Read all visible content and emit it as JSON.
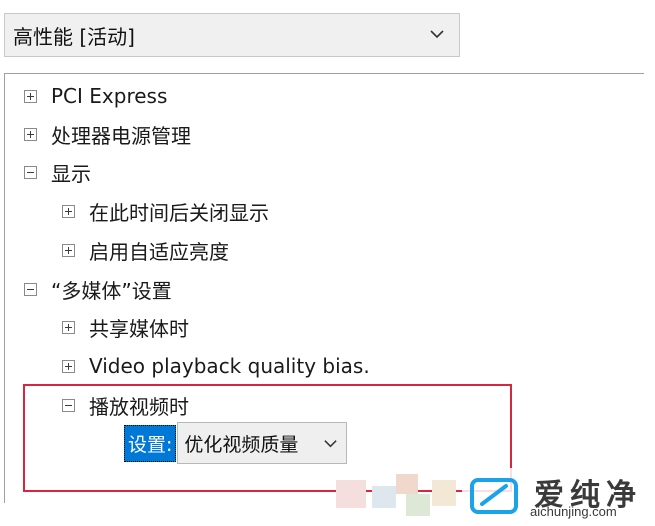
{
  "plan_select": {
    "value": "高性能 [活动]",
    "icon": "chevron-down-icon"
  },
  "tree": {
    "pci": {
      "label": "PCI Express",
      "state": "collapsed"
    },
    "cpu_power": {
      "label": "处理器电源管理",
      "state": "collapsed"
    },
    "display": {
      "label": "显示",
      "state": "expanded"
    },
    "display_off": {
      "label": "在此时间后关闭显示",
      "state": "collapsed"
    },
    "adaptive_brightness": {
      "label": "启用自适应亮度",
      "state": "collapsed"
    },
    "multimedia": {
      "label": "“多媒体”设置",
      "state": "expanded"
    },
    "media_sharing": {
      "label": "共享媒体时",
      "state": "collapsed"
    },
    "video_bias": {
      "label": "Video playback quality bias.",
      "state": "collapsed"
    },
    "play_video": {
      "label": "播放视频时",
      "state": "expanded"
    }
  },
  "setting": {
    "label": "设置:",
    "value": "优化视频质量",
    "icon": "chevron-down-icon"
  },
  "colors": {
    "highlight_frame": "#d7263d",
    "selection": "#0078d7",
    "watermark_accent": "#1aa3e8"
  },
  "watermark": {
    "brand": "爱纯净",
    "url": "aichunjing.com"
  }
}
